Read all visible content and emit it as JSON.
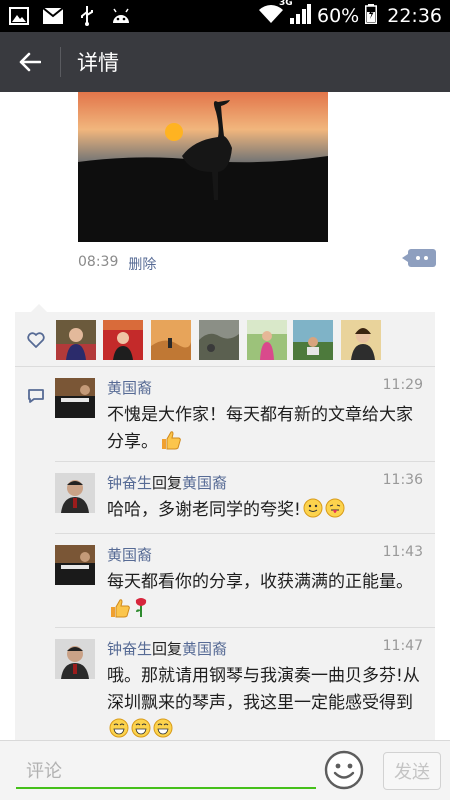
{
  "status_bar": {
    "icons_left": [
      "image-icon",
      "mail-icon",
      "usb-icon",
      "android-icon"
    ],
    "network": "3G",
    "battery": "60%",
    "time": "22:36"
  },
  "header": {
    "title": "详情"
  },
  "post": {
    "time": "08:39",
    "delete_label": "删除"
  },
  "likes": {
    "avatars": [
      "avatar-1",
      "avatar-2",
      "avatar-3",
      "avatar-4",
      "avatar-5",
      "avatar-6",
      "avatar-7"
    ]
  },
  "comments": [
    {
      "name": "黄国裔",
      "reply_word": "",
      "reply_to": "",
      "time": "11:29",
      "text": "不愧是大作家！每天都有新的文章给大家分享。",
      "emojis": [
        "thumbs-up"
      ]
    },
    {
      "name": "钟奋生",
      "reply_word": "回复",
      "reply_to": "黄国裔",
      "time": "11:36",
      "text": "哈哈，多谢老同学的夸奖!",
      "emojis": [
        "smile",
        "tongue"
      ]
    },
    {
      "name": "黄国裔",
      "reply_word": "",
      "reply_to": "",
      "time": "11:43",
      "text": "每天都看你的分享，收获满满的正能量。",
      "emojis": [
        "thumbs-up",
        "rose"
      ]
    },
    {
      "name": "钟奋生",
      "reply_word": "回复",
      "reply_to": "黄国裔",
      "time": "11:47",
      "text": "哦。那就请用钢琴与我演奏一曲贝多芬!从深圳飘来的琴声，我这里一定能感受得到",
      "emojis": [
        "grin",
        "grin",
        "grin"
      ]
    }
  ],
  "bottom": {
    "placeholder": "评论",
    "send_label": "发送"
  },
  "colors": {
    "accent_green": "#45c01a",
    "link_blue": "#576b95",
    "header_bg": "#393a3f"
  }
}
